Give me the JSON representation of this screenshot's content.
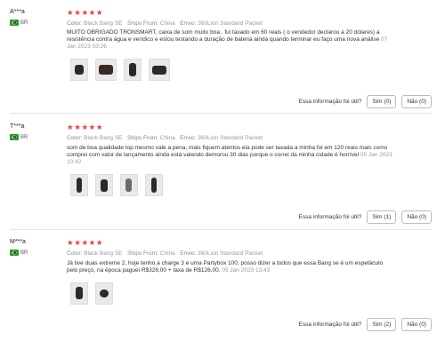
{
  "reviews": [
    {
      "user": "A***a",
      "country": "BR",
      "rating": 5,
      "meta": {
        "color_label": "Color:",
        "color": "Black Bang SE",
        "ships_label": "Ships From:",
        "ships": "China",
        "envio_label": "Envio:",
        "envio": "360Lion Standard Packet"
      },
      "text": "MUITO OBRIGADO TRONSMART, caixa de som muito boa , fui taxado em 60 reais ( o vendedor declarou a 20 dólares) a resistência contra água e verídico e estou testando a duração de bateria ainda quando terminar eu faço uma nova análise",
      "date": "07 Jan 2023 03:26",
      "helpful": "Essa informação foi útil?",
      "yes": "Sim (0)",
      "no": "Não (0)"
    },
    {
      "user": "T***a",
      "country": "BR",
      "rating": 5,
      "meta": {
        "color_label": "Color:",
        "color": "Black Bang SE",
        "ships_label": "Ships From:",
        "ships": "China",
        "envio_label": "Envio:",
        "envio": "360Lion Standard Packet"
      },
      "text": "som de boa qualidade top mesmo vale a pena, mais fiquem atentos ela pode ser taxada a minha foi em 120 reais mais como comprei com valor de lançamento ainda está valendo demorou 30 dias porque o correi da minha cidade é horrível",
      "date": "05 Jan 2023 10:42",
      "helpful": "Essa informação foi útil?",
      "yes": "Sim (1)",
      "no": "Não (0)"
    },
    {
      "user": "M***a",
      "country": "BR",
      "rating": 5,
      "meta": {
        "color_label": "Color:",
        "color": "Black Bang SE",
        "ships_label": "Ships From:",
        "ships": "China",
        "envio_label": "Envio:",
        "envio": "360Lion Standard Packet"
      },
      "text": "Já tive duas extreme 2, hoje tenho a charge 3 e uma Partybox 100, posso dizer a todos que essa Bang se é um espetáculo pelo preço, na época paguei R$326,00 + taxa de R$126,00.",
      "date": "05 Jan 2023 13:43",
      "helpful": "Essa informação foi útil?",
      "yes": "Sim (2)",
      "no": "Não (0)"
    }
  ],
  "stars_glyph": "★★★★★"
}
